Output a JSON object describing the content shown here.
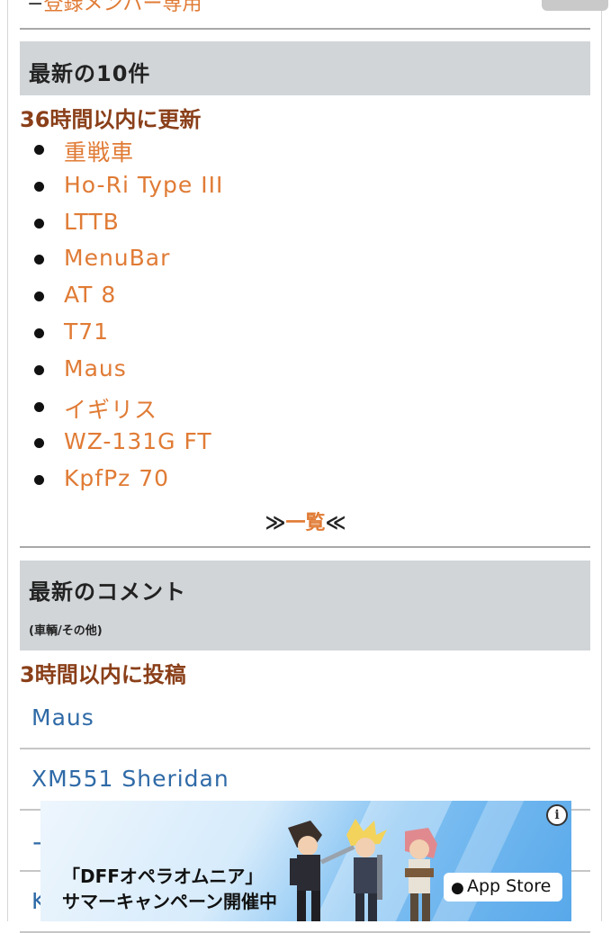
{
  "top": {
    "dash": "−",
    "members_link": "登録メンバー専用"
  },
  "latest_updates": {
    "title": "最新の10件",
    "subheading": "36時間以内に更新",
    "items": [
      "重戦車",
      "Ho-Ri Type III",
      "LTTB",
      "MenuBar",
      "AT 8",
      "T71",
      "Maus",
      "イギリス",
      "WZ-131G FT",
      "KpfPz 70"
    ],
    "more_left": "≫",
    "more_label": "一覧",
    "more_right": "≪"
  },
  "latest_comments": {
    "title": "最新のコメント",
    "subtitle": "(車輌/その他)",
    "subheading": "3時間以内に投稿",
    "items": [
      "Maus",
      "XM551 Sheridan",
      "ー",
      "K"
    ]
  },
  "ad": {
    "line1": "「DFFオペラオムニア」",
    "line2": "サマーキャンペーン開催中",
    "store_label": "App Store",
    "info": "i"
  }
}
